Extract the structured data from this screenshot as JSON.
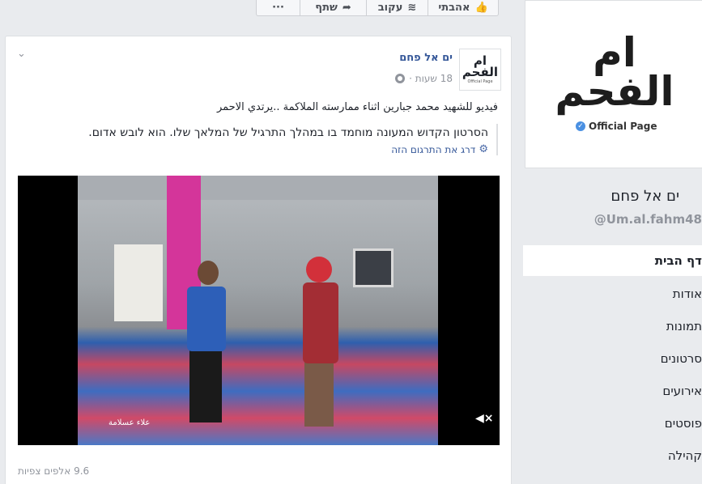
{
  "top_actions": {
    "like": "אהבתי",
    "follow": "עקוב",
    "share": "שתף",
    "more": "···"
  },
  "post": {
    "page_name": "ים אל פחם",
    "avatar_text": "ام الفحم",
    "avatar_sub": "Official Page",
    "time": "18 שעות ·",
    "original_text": "فيديو للشهيد محمد جبارين اثناء ممارسته الملاكمة ..يرتدي الاحمر",
    "translation": "הסרטון הקדוש המעונה מוחמד בו במהלך התרגיל של המלאך שלו. הוא לובש אדום.",
    "rate_translation": "דרג את התרגום הזה",
    "video_watermark": "علاء عسلامة",
    "views": "9.6 אלפים צפיות"
  },
  "page_card": {
    "logo_text": "ام الفحم",
    "official_label": "Official Page",
    "page_name": "ים אל פחם",
    "handle": "Um.al.fahm48@"
  },
  "nav": {
    "items": [
      {
        "label": "דף הבית"
      },
      {
        "label": "אודות"
      },
      {
        "label": "תמונות"
      },
      {
        "label": "סרטונים"
      },
      {
        "label": "אירועים"
      },
      {
        "label": "פוסטים"
      },
      {
        "label": "קהילה"
      }
    ]
  },
  "icons": {
    "like": "thumbs-up-icon",
    "follow": "rss-icon",
    "share": "share-arrow-icon",
    "more": "more-icon",
    "audience": "globe-icon",
    "settings": "gear-icon",
    "mute": "speaker-muted-icon",
    "menu": "chevron-down-icon"
  },
  "colors": {
    "link": "#365899",
    "meta": "#90949c",
    "background": "#e9ebee",
    "verified": "#4a90e2"
  }
}
